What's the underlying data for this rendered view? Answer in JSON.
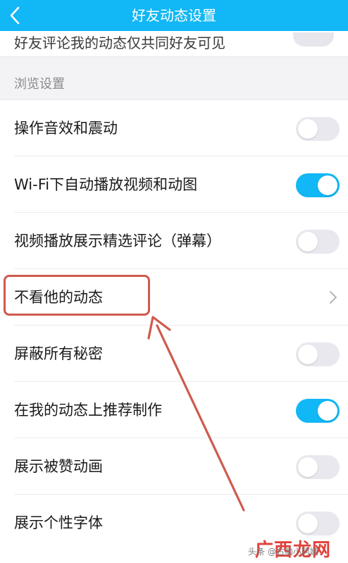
{
  "header": {
    "title": "好友动态设置",
    "back_icon": "chevron-left-icon"
  },
  "partial_row": {
    "label": "好友评论我的动态仅共同好友可见",
    "toggle_on": false
  },
  "section": {
    "title": "浏览设置"
  },
  "settings": [
    {
      "label": "操作音效和震动",
      "control": "toggle",
      "on": false
    },
    {
      "label": "Wi-Fi下自动播放视频和动图",
      "control": "toggle",
      "on": true
    },
    {
      "label": "视频播放展示精选评论（弹幕）",
      "control": "toggle",
      "on": false
    },
    {
      "label": "不看他的动态",
      "control": "chevron"
    },
    {
      "label": "屏蔽所有秘密",
      "control": "toggle",
      "on": false
    },
    {
      "label": "在我的动态上推荐制作",
      "control": "toggle",
      "on": true
    },
    {
      "label": "展示被赞动画",
      "control": "toggle",
      "on": false
    },
    {
      "label": "展示个性字体",
      "control": "toggle",
      "on": false
    }
  ],
  "annotation": {
    "box_color": "#cf5a4e",
    "arrow_color": "#cf5a4e"
  },
  "watermark": {
    "small_text": "头条 @右脑小阿姨",
    "big_text": "广西龙网"
  },
  "colors": {
    "accent": "#12b7f5",
    "toggle_off": "#e8e8ee"
  }
}
